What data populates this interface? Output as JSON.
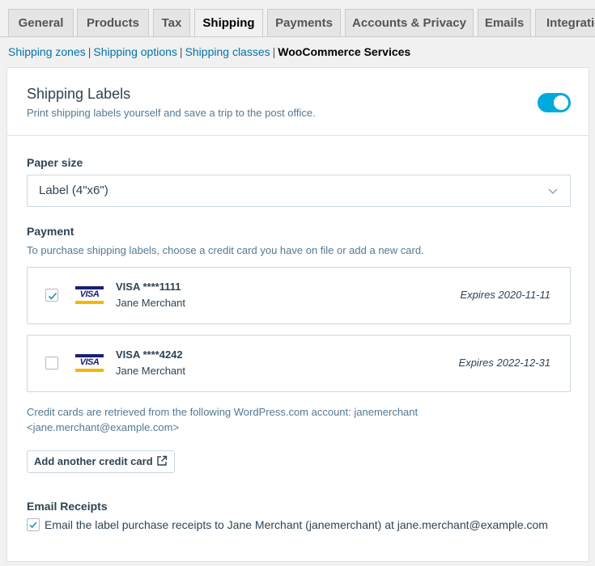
{
  "tabs": [
    "General",
    "Products",
    "Tax",
    "Shipping",
    "Payments",
    "Accounts & Privacy",
    "Emails",
    "Integration"
  ],
  "subnav": {
    "links": [
      "Shipping zones",
      "Shipping options",
      "Shipping classes"
    ],
    "current": "WooCommerce Services"
  },
  "shipping_labels": {
    "title": "Shipping Labels",
    "description": "Print shipping labels yourself and save a trip to the post office.",
    "enabled": true
  },
  "paper_size": {
    "label": "Paper size",
    "selected": "Label (4\"x6\")"
  },
  "payment": {
    "label": "Payment",
    "description": "To purchase shipping labels, choose a credit card you have on file or add a new card.",
    "cards": [
      {
        "brand": "VISA",
        "number": "VISA ****1111",
        "name": "Jane Merchant",
        "expires": "Expires 2020-11-11",
        "checked": true
      },
      {
        "brand": "VISA",
        "number": "VISA ****4242",
        "name": "Jane Merchant",
        "expires": "Expires 2022-12-31",
        "checked": false
      }
    ],
    "account_note": "Credit cards are retrieved from the following WordPress.com account: janemerchant <jane.merchant@example.com>",
    "add_button": "Add another credit card"
  },
  "email_receipts": {
    "label": "Email Receipts",
    "text": "Email the label purchase receipts to Jane Merchant (janemerchant) at jane.merchant@example.com",
    "checked": true
  },
  "colors": {
    "accent": "#00aadc",
    "link": "#0073aa"
  }
}
